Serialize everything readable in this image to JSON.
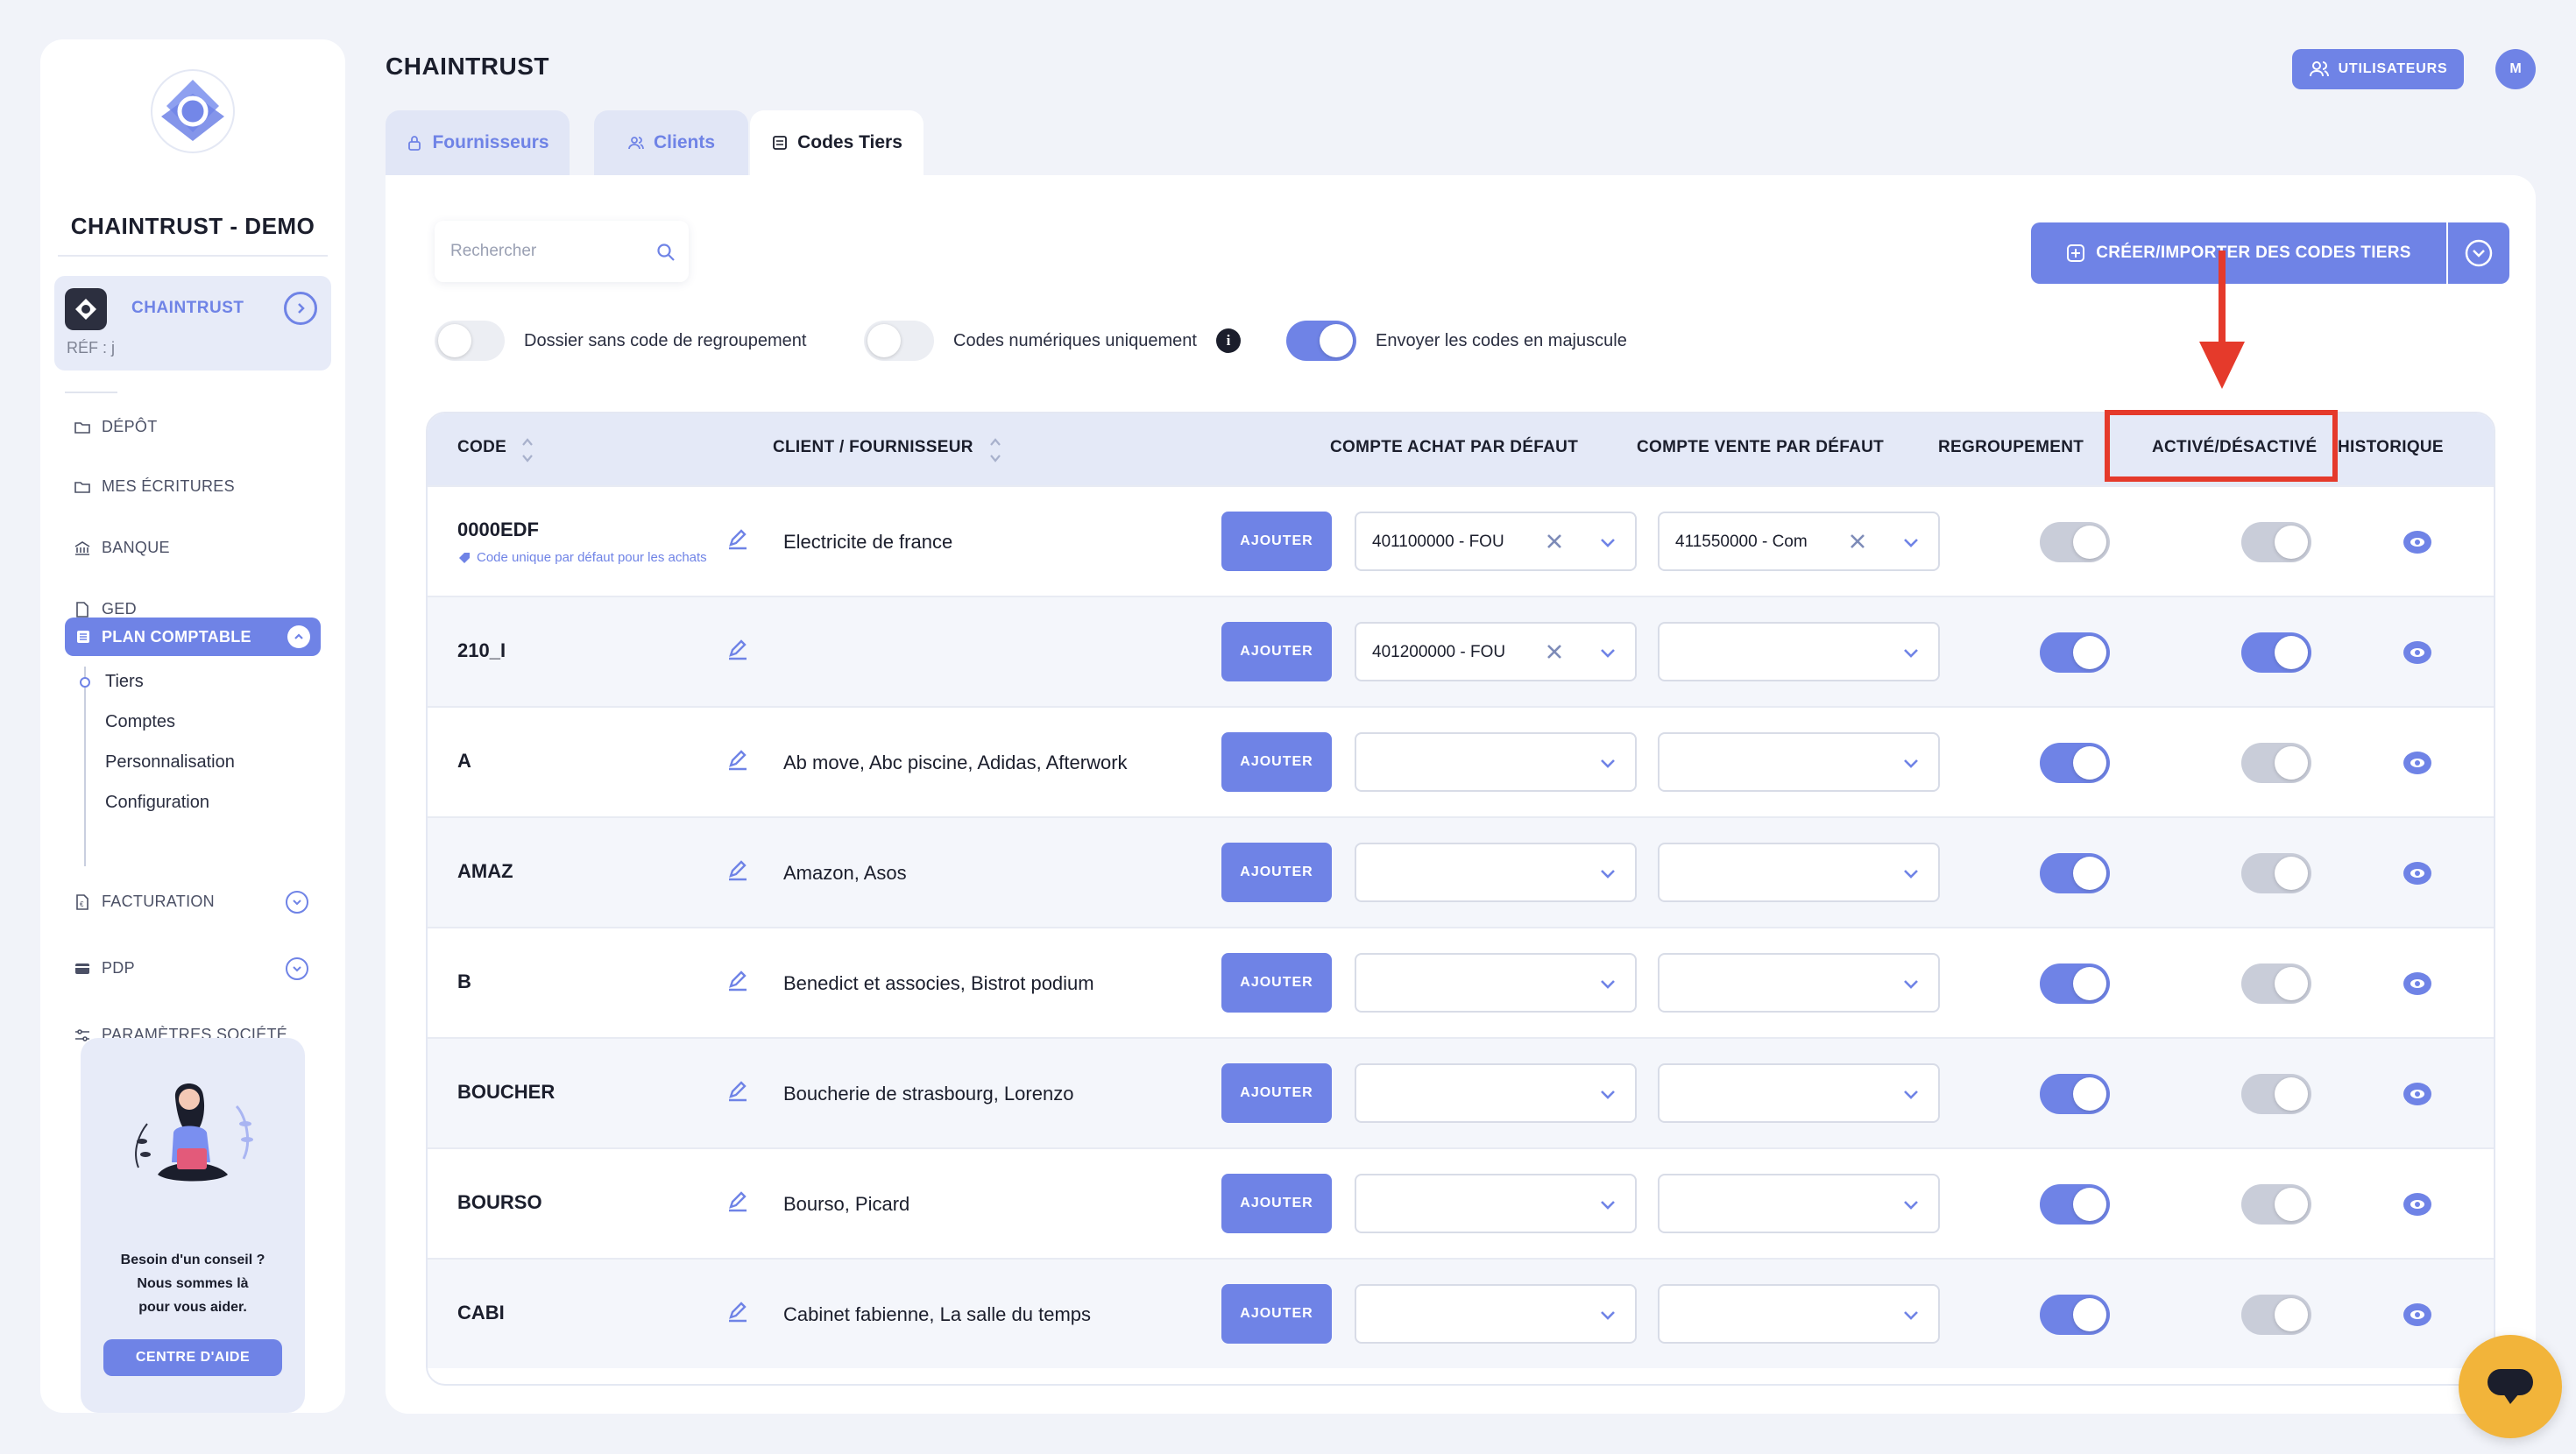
{
  "sidebar": {
    "company_name": "CHAINTRUST - DEMO",
    "client": {
      "name": "CHAINTRUST",
      "ref": "RÉF : j"
    },
    "nav": [
      {
        "label": "DÉPÔT",
        "icon": "folder-icon"
      },
      {
        "label": "MES ÉCRITURES",
        "icon": "folder-icon"
      },
      {
        "label": "BANQUE",
        "icon": "bank-icon"
      },
      {
        "label": "GED",
        "icon": "document-icon"
      }
    ],
    "active_section": "PLAN COMPTABLE",
    "sub_nav": [
      "Tiers",
      "Comptes",
      "Personnalisation",
      "Configuration"
    ],
    "facturation": "FACTURATION",
    "pdp": "PDP",
    "parametres": "PARAMÈTRES SOCIÉTÉ",
    "help": {
      "line1": "Besoin d'un conseil ?",
      "line2": "Nous sommes là",
      "line3": "pour vous aider.",
      "button": "CENTRE D'AIDE"
    }
  },
  "header": {
    "title": "CHAINTRUST",
    "users_button": "UTILISATEURS",
    "avatar_initial": "M"
  },
  "tabs": [
    {
      "label": "Fournisseurs",
      "icon": "lock-icon",
      "active": false
    },
    {
      "label": "Clients",
      "icon": "users-icon",
      "active": false
    },
    {
      "label": "Codes Tiers",
      "icon": "list-icon",
      "active": true
    }
  ],
  "toolbar": {
    "search_placeholder": "Rechercher",
    "create_button": "CRÉER/IMPORTER DES CODES TIERS"
  },
  "options": [
    {
      "label": "Dossier sans code de regroupement",
      "state": "off"
    },
    {
      "label": "Codes numériques uniquement",
      "state": "off",
      "info": "i"
    },
    {
      "label": "Envoyer les codes en majuscule",
      "state": "on"
    }
  ],
  "table": {
    "columns": {
      "code": "CODE",
      "client": "CLIENT / FOURNISSEUR",
      "achat": "COMPTE ACHAT PAR DÉFAUT",
      "vente": "COMPTE VENTE PAR DÉFAUT",
      "regroupement": "REGROUPEMENT",
      "active": "ACTIVÉ/DÉSACTIVÉ",
      "historique": "HISTORIQUE"
    },
    "add_label": "AJOUTER",
    "rows": [
      {
        "code": "0000EDF",
        "sub": "Code unique par défaut pour les achats",
        "client": "Electricite de france",
        "achat": "401100000 - FOU",
        "vente": "411550000 - Com",
        "regroupement": "dim",
        "active": "dim"
      },
      {
        "code": "210_I",
        "sub": "",
        "client": "",
        "achat": "401200000 - FOU",
        "vente": "",
        "regroupement": "on",
        "active": "on"
      },
      {
        "code": "A",
        "sub": "",
        "client": "Ab move, Abc piscine, Adidas, Afterwork",
        "achat": "",
        "vente": "",
        "regroupement": "on",
        "active": "dim"
      },
      {
        "code": "AMAZ",
        "sub": "",
        "client": "Amazon, Asos",
        "achat": "",
        "vente": "",
        "regroupement": "on",
        "active": "dim"
      },
      {
        "code": "B",
        "sub": "",
        "client": "Benedict et associes, Bistrot podium",
        "achat": "",
        "vente": "",
        "regroupement": "on",
        "active": "dim"
      },
      {
        "code": "BOUCHER",
        "sub": "",
        "client": "Boucherie de strasbourg, Lorenzo",
        "achat": "",
        "vente": "",
        "regroupement": "on",
        "active": "dim"
      },
      {
        "code": "BOURSO",
        "sub": "",
        "client": "Bourso, Picard",
        "achat": "",
        "vente": "",
        "regroupement": "on",
        "active": "dim"
      },
      {
        "code": "CABI",
        "sub": "",
        "client": "Cabinet fabienne, La salle du temps",
        "achat": "",
        "vente": "",
        "regroupement": "on",
        "active": "dim"
      }
    ]
  },
  "colors": {
    "accent": "#6f83e6",
    "annotation": "#e53a2b",
    "chat": "#f2b43a"
  }
}
